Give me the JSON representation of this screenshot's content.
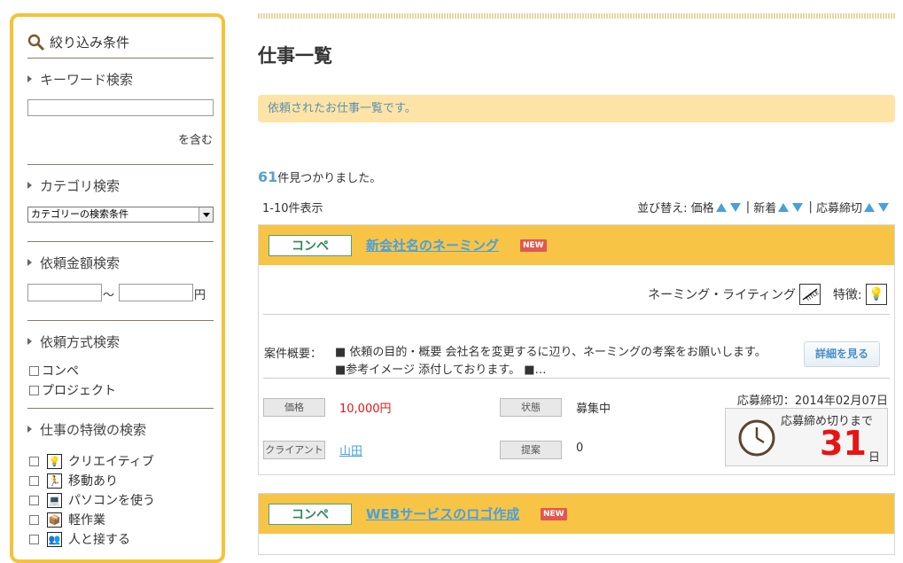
{
  "sidebar": {
    "title": "絞り込み条件",
    "keyword": {
      "heading": "キーワード検索",
      "value": "",
      "suffix": "を含む"
    },
    "category": {
      "heading": "カテゴリ検索",
      "selected": "カテゴリーの検索条件"
    },
    "amount": {
      "heading": "依頼金額検索",
      "min": "",
      "max": "",
      "separator": "～",
      "unit": "円"
    },
    "method": {
      "heading": "依頼方式検索",
      "options": [
        "コンペ",
        "プロジェクト"
      ]
    },
    "features": {
      "heading": "仕事の特徴の検索",
      "options": [
        {
          "label": "クリエイティブ",
          "icon": "lightbulb-icon"
        },
        {
          "label": "移動あり",
          "icon": "running-person-icon"
        },
        {
          "label": "パソコンを使う",
          "icon": "computer-icon"
        },
        {
          "label": "軽作業",
          "icon": "box-icon"
        },
        {
          "label": "人と接する",
          "icon": "people-icon"
        }
      ]
    }
  },
  "main": {
    "title": "仕事一覧",
    "notice": "依頼されたお仕事一覧です。",
    "count_number": "61",
    "count_text": "件見つかりました。",
    "range": "1-10件表示",
    "sort": {
      "label": "並び替え:",
      "price": "価格",
      "newest": "新着",
      "deadline": "応募締切",
      "separator": "|"
    }
  },
  "jobs": [
    {
      "type": "コンペ",
      "title": "新会社名のネーミング",
      "new_badge": "NEW",
      "category": "ネーミング・ライティング",
      "category_icon": "title-icon",
      "feature_label": "特徴:",
      "feature_icon": "lightbulb-icon",
      "summary_label": "案件概要：",
      "summary": "■ 依頼の目的・概要 会社名を変更するに辺り、ネーミングの考案をお願いします。 ■参考イメージ 添付しております。 ■…",
      "detail_button": "詳細を見る",
      "price_label": "価格",
      "price": "10,000円",
      "status_label": "状態",
      "status": "募集中",
      "client_label": "クライアント",
      "client": "山田",
      "proposal_label": "提案",
      "proposals": "0",
      "deadline": "応募締切：2014年02月07日",
      "remaining_label": "応募締め切りまで",
      "remaining_days": "31",
      "remaining_unit": "日"
    },
    {
      "type": "コンペ",
      "title": "WEBサービスのロゴ作成",
      "new_badge": "NEW"
    }
  ],
  "colors": {
    "accent_yellow": "#f8c446",
    "link_blue": "#4aa0db",
    "price_red": "#e51515",
    "badge_green": "#2e8a57"
  }
}
